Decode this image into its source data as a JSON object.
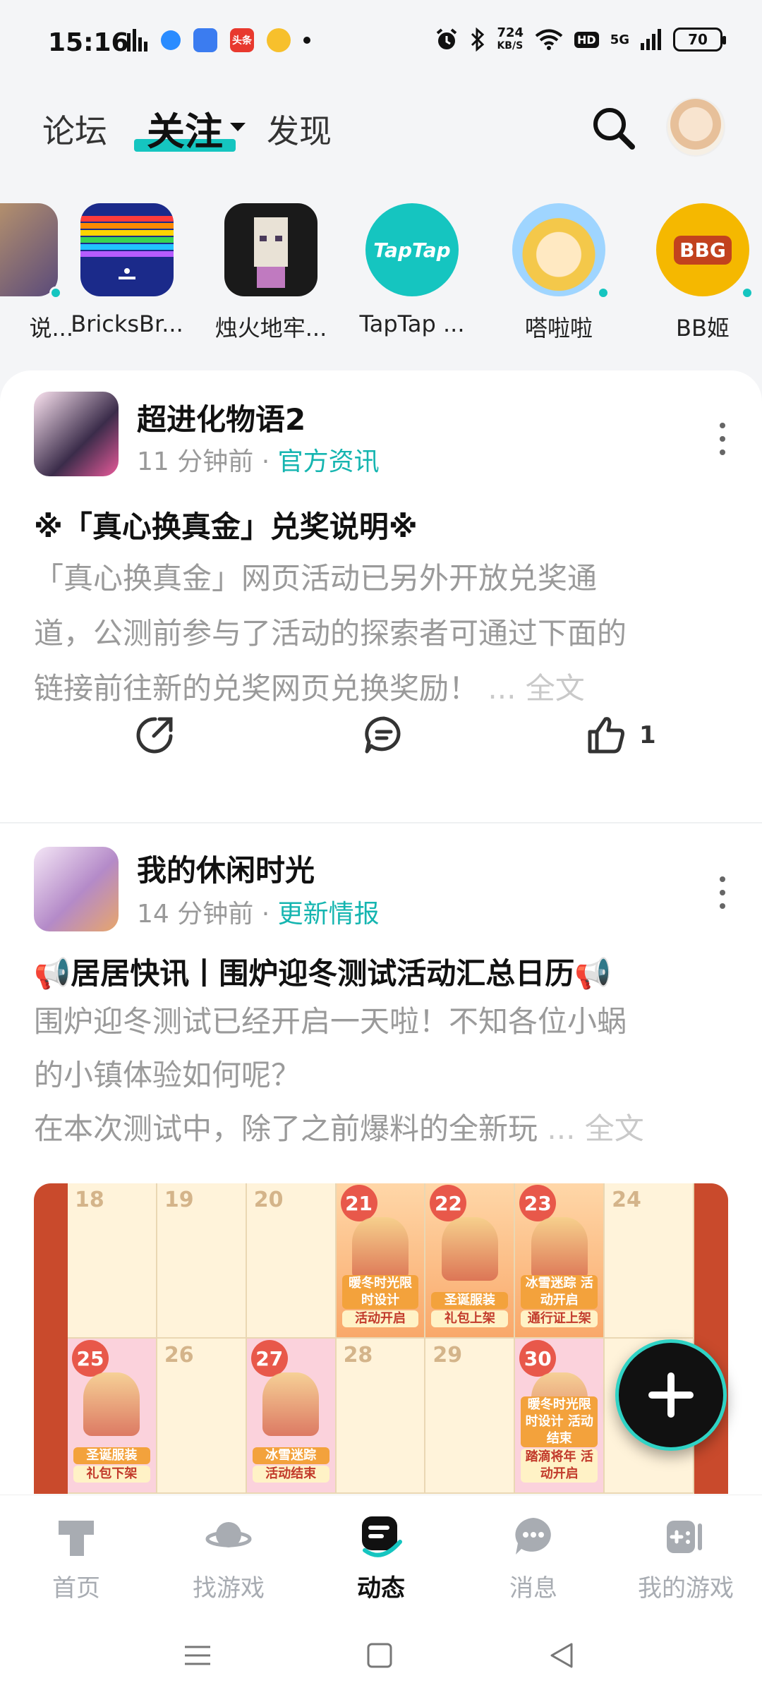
{
  "status_bar": {
    "time": "15:16",
    "net_speed_top": "724",
    "net_speed_unit": "KB/S",
    "hd": "HD",
    "signal": "5G",
    "battery": "70",
    "app_badges": [
      "头条"
    ]
  },
  "top_tabs": {
    "forum": "论坛",
    "follow": "关注",
    "discover": "发现"
  },
  "followed": [
    {
      "name": "说...",
      "color": "#6b5a8c",
      "dot": true
    },
    {
      "name": "BricksBr...",
      "color": "#1b2a8a",
      "dot": false
    },
    {
      "name": "烛火地牢...",
      "color": "#1a1a1a",
      "dot": false
    },
    {
      "name": "TapTap ...",
      "color": "#15c5c0",
      "logo": "TapTap",
      "dot": false
    },
    {
      "name": "嗒啦啦",
      "color": "#cfe8ff",
      "dot": true
    },
    {
      "name": "BB姬",
      "color": "#f5b800",
      "logo": "BBG",
      "dot": true
    }
  ],
  "posts": [
    {
      "author": "超进化物语2",
      "time": "11 分钟前",
      "category": "官方资讯",
      "title": "※「真心换真金」兑奖说明※",
      "body_lines": [
        "「真心换真金」网页活动已另外开放兑奖通",
        "道，公测前参与了活动的探索者可通过下面的",
        "链接前往新的兑奖网页兑换奖励！"
      ],
      "more": "... 全文",
      "likes": "1"
    },
    {
      "author": "我的休闲时光",
      "time": "14 分钟前",
      "category": "更新情报",
      "title": "📢居居快讯丨围炉迎冬测试活动汇总日历📢",
      "body_lines": [
        "围炉迎冬测试已经开启一天啦！不知各位小蜗",
        "的小镇体验如何呢？",
        "在本次测试中，除了之前爆料的全新玩"
      ],
      "more": "... 全文"
    }
  ],
  "calendar": {
    "row1": [
      {
        "day": "18"
      },
      {
        "day": "19"
      },
      {
        "day": "20"
      },
      {
        "day": "21",
        "event": true,
        "tag_a": "暖冬时光限时设计",
        "tag_b": "活动开启"
      },
      {
        "day": "22",
        "event": true,
        "tag_a": "圣诞服装",
        "tag_b": "礼包上架"
      },
      {
        "day": "23",
        "event": true,
        "tag_a": "冰雪迷踪 活动开启",
        "tag_b": "通行证上架"
      },
      {
        "day": "24"
      }
    ],
    "row2": [
      {
        "day": "25",
        "pink": true,
        "tag_a": "圣诞服装",
        "tag_b": "礼包下架"
      },
      {
        "day": "26"
      },
      {
        "day": "27",
        "pink": true,
        "tag_a": "冰雪迷踪",
        "tag_b": "活动结束"
      },
      {
        "day": "28"
      },
      {
        "day": "29"
      },
      {
        "day": "30",
        "pink": true,
        "tag_a": "暖冬时光限时设计 活动结束",
        "tag_b": "踏滴将年 活动开启"
      },
      {
        "day": ""
      }
    ]
  },
  "bottom_nav": {
    "home": "首页",
    "find": "找游戏",
    "feed": "动态",
    "msg": "消息",
    "mygames": "我的游戏"
  },
  "colors": {
    "accent": "#15c5c0",
    "category": "#15b5b0"
  }
}
